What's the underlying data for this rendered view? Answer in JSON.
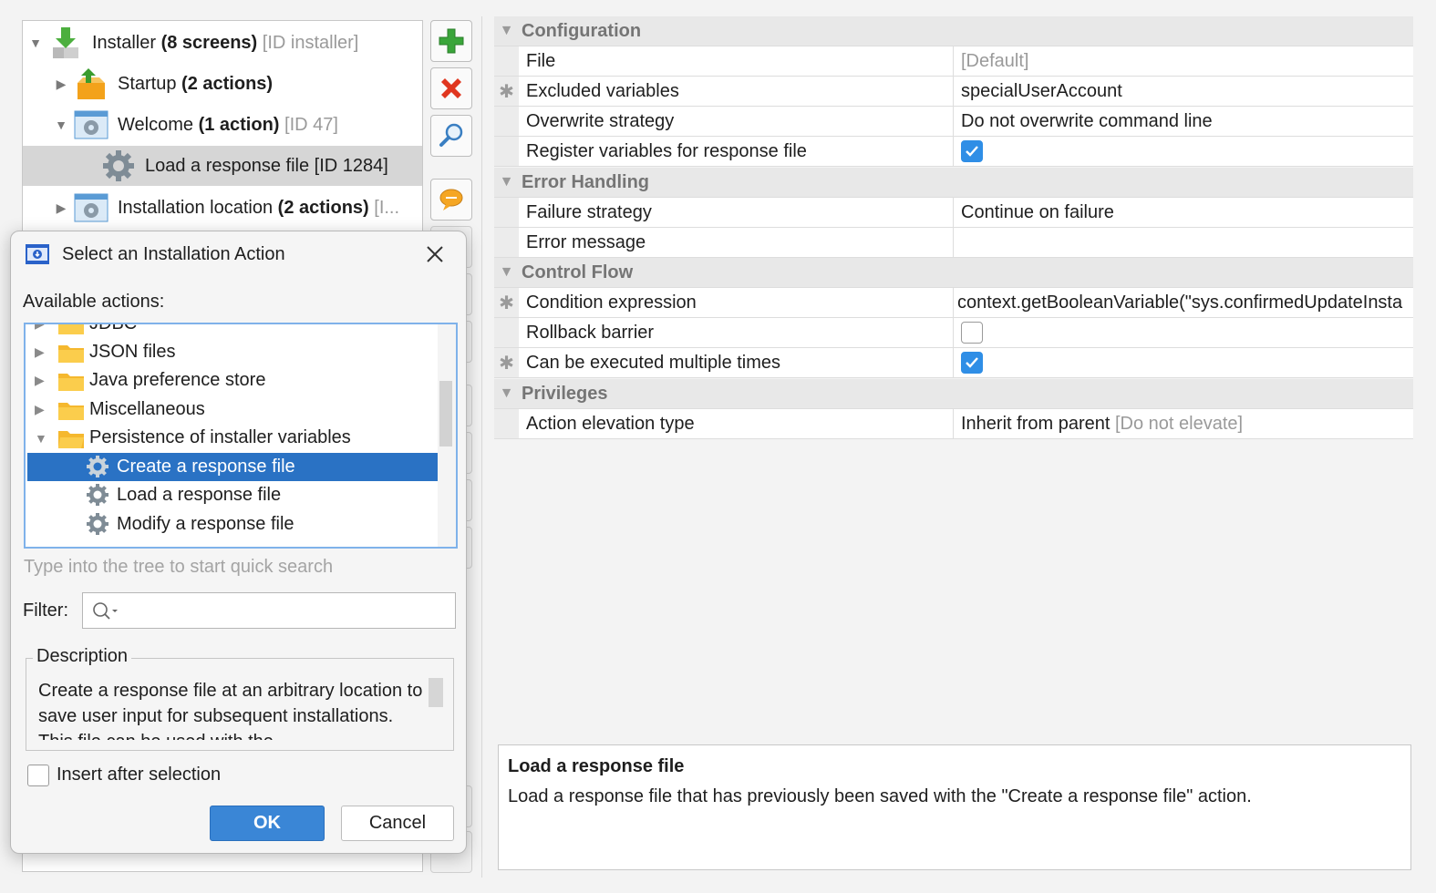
{
  "tree": {
    "root": {
      "label": "Installer",
      "count": "(8 screens)",
      "id": "[ID installer]"
    },
    "startup": {
      "label": "Startup",
      "count": "(2 actions)"
    },
    "welcome": {
      "label": "Welcome",
      "count": "(1 action)",
      "id": "[ID 47]"
    },
    "load_action": {
      "label": "Load a response file [ID 1284]"
    },
    "install_location": {
      "label": "Installation location",
      "count": "(2 actions)",
      "id": "[I..."
    }
  },
  "toolbar": {
    "add_icon": "plus-icon",
    "delete_icon": "delete-icon",
    "search_icon": "magnifier-icon",
    "comment_icon": "comment-icon"
  },
  "properties": {
    "configuration": {
      "title": "Configuration",
      "file": {
        "name": "File",
        "value": "[Default]"
      },
      "excluded": {
        "name": "Excluded variables",
        "value": "specialUserAccount",
        "marker": "✱"
      },
      "overwrite": {
        "name": "Overwrite strategy",
        "value": "Do not overwrite command line"
      },
      "register": {
        "name": "Register variables for response file",
        "checked": true
      }
    },
    "error_handling": {
      "title": "Error Handling",
      "failure": {
        "name": "Failure strategy",
        "value": "Continue on failure"
      },
      "message": {
        "name": "Error message",
        "value": ""
      }
    },
    "control_flow": {
      "title": "Control Flow",
      "condition": {
        "name": "Condition expression",
        "value": "context.getBooleanVariable(\"sys.confirmedUpdateInsta",
        "marker": "✱"
      },
      "rollback": {
        "name": "Rollback barrier",
        "checked": false
      },
      "multiple": {
        "name": "Can be executed multiple times",
        "checked": true,
        "marker": "✱"
      }
    },
    "privileges": {
      "title": "Privileges",
      "elevation": {
        "name": "Action elevation type",
        "value": "Inherit from parent",
        "value_hint": "[Do not elevate]"
      }
    }
  },
  "help": {
    "title": "Load a response file",
    "text": "Load a response file that has previously been saved with the \"Create a response file\" action."
  },
  "dialog": {
    "title": "Select an Installation Action",
    "available_label": "Available actions:",
    "items": [
      {
        "label": "JDBC"
      },
      {
        "label": "JSON files"
      },
      {
        "label": "Java preference store"
      },
      {
        "label": "Miscellaneous"
      },
      {
        "label": "Persistence of installer variables"
      },
      {
        "label": "Create a response file"
      },
      {
        "label": "Load a response file"
      },
      {
        "label": "Modify a response file"
      }
    ],
    "hint": "Type into the tree to start quick search",
    "filter_label": "Filter:",
    "filter_value": "",
    "description_legend": "Description",
    "description_text": "Create a response file at an arbitrary location to save user input for subsequent installations. This file can be used with the",
    "insert_after_label": "Insert after selection",
    "insert_after_checked": false,
    "ok_label": "OK",
    "cancel_label": "Cancel"
  },
  "colors": {
    "selection": "#2a72c4",
    "accent": "#2f8ee6",
    "ok_button": "#3a86d6"
  }
}
